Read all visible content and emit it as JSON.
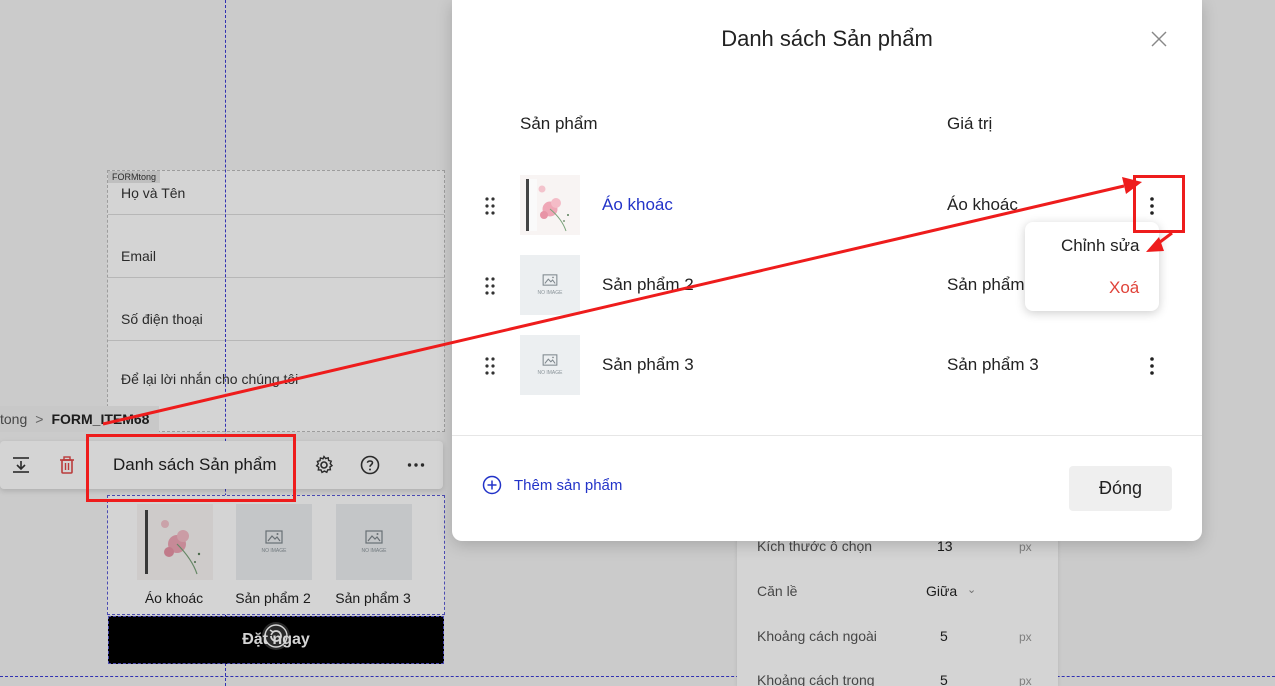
{
  "colors": {
    "accent_blue": "#2233c8",
    "delete_red": "#e0433a",
    "annotation_red": "#ee1c1c",
    "guide_blue": "#3b3bd6"
  },
  "editor": {
    "form_tag": "FORMtong",
    "form_fields": [
      "Họ và Tên",
      "Email",
      "Số điện thoại",
      "Để lại lời nhắn cho chúng tôi"
    ],
    "breadcrumb": {
      "first": "tong",
      "separator": ">",
      "current": "FORM_ITEM68"
    },
    "toolbar": {
      "label": "Danh sách Sản phẩm",
      "icons": [
        "move-down-icon",
        "trash-icon",
        "gear-icon",
        "help-icon",
        "more-horizontal-icon"
      ]
    },
    "products_strip": [
      {
        "name": "Áo khoác",
        "image": "floral"
      },
      {
        "name": "Sản phẩm 2",
        "image": "no-image"
      },
      {
        "name": "Sản phẩm 3",
        "image": "no-image"
      }
    ],
    "order_button": "Đặt ngay",
    "no_image_text": "NO IMAGE",
    "settings": [
      {
        "label": "Kích thước ô chọn",
        "value": "13",
        "unit": "px"
      },
      {
        "label": "Căn lề",
        "value": "Giữa",
        "unit": ""
      },
      {
        "label": "Khoảng cách ngoài",
        "value": "5",
        "unit": "px"
      },
      {
        "label": "Khoảng cách trong",
        "value": "5",
        "unit": "px"
      }
    ]
  },
  "modal": {
    "title": "Danh sách Sản phẩm",
    "columns": {
      "product": "Sản phẩm",
      "value": "Giá trị"
    },
    "rows": [
      {
        "name": "Áo khoác",
        "value": "Áo khoác",
        "image": "floral",
        "is_link": true
      },
      {
        "name": "Sản phẩm 2",
        "value": "Sản phẩm 2",
        "image": "no-image",
        "is_link": false
      },
      {
        "name": "Sản phẩm 3",
        "value": "Sản phẩm 3",
        "image": "no-image",
        "is_link": false
      }
    ],
    "add_label": "Thêm sản phẩm",
    "close_label": "Đóng",
    "row_menu": {
      "edit": "Chỉnh sửa",
      "delete": "Xoá"
    }
  }
}
